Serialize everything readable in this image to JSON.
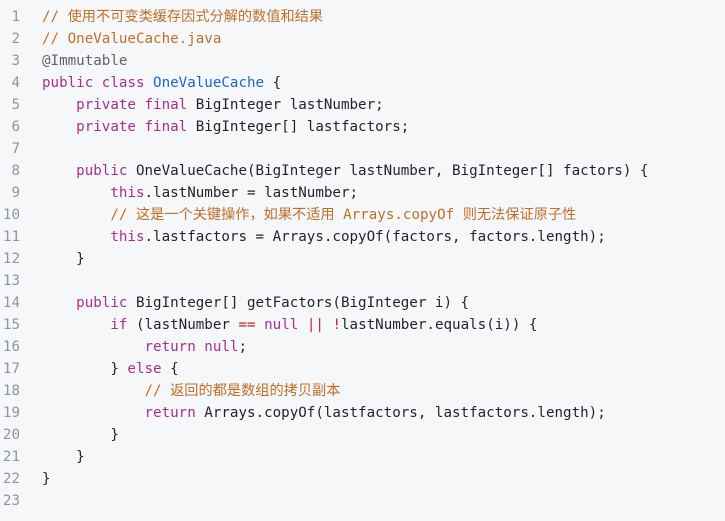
{
  "colors": {
    "background": "#f6f7f9",
    "line_number": "#8f959e",
    "comment": "#c06f2a",
    "keyword": "#a72f8a",
    "type": "#1967d2",
    "annotation": "#5f6368",
    "text": "#1f2329"
  },
  "lines": [
    {
      "n": "1",
      "tokens": [
        {
          "t": "// 使用不可变类缓存因式分解的数值和结果",
          "c": "cm"
        }
      ]
    },
    {
      "n": "2",
      "tokens": [
        {
          "t": "// OneValueCache.java",
          "c": "cm"
        }
      ]
    },
    {
      "n": "3",
      "tokens": [
        {
          "t": "@Immutable",
          "c": "at"
        }
      ]
    },
    {
      "n": "4",
      "tokens": [
        {
          "t": "public class ",
          "c": "kw"
        },
        {
          "t": "OneValueCache",
          "c": "ty"
        },
        {
          "t": " {",
          "c": "tx"
        }
      ]
    },
    {
      "n": "5",
      "tokens": [
        {
          "t": "    ",
          "c": "tx"
        },
        {
          "t": "private final ",
          "c": "kw"
        },
        {
          "t": "BigInteger lastNumber;",
          "c": "tx"
        }
      ]
    },
    {
      "n": "6",
      "tokens": [
        {
          "t": "    ",
          "c": "tx"
        },
        {
          "t": "private final ",
          "c": "kw"
        },
        {
          "t": "BigInteger[] lastfactors;",
          "c": "tx"
        }
      ]
    },
    {
      "n": "7",
      "tokens": []
    },
    {
      "n": "8",
      "tokens": [
        {
          "t": "    ",
          "c": "tx"
        },
        {
          "t": "public ",
          "c": "kw"
        },
        {
          "t": "OneValueCache(BigInteger lastNumber, BigInteger[] factors) {",
          "c": "tx"
        }
      ]
    },
    {
      "n": "9",
      "tokens": [
        {
          "t": "        ",
          "c": "tx"
        },
        {
          "t": "this",
          "c": "kw"
        },
        {
          "t": ".lastNumber = lastNumber;",
          "c": "tx"
        }
      ]
    },
    {
      "n": "10",
      "tokens": [
        {
          "t": "        ",
          "c": "tx"
        },
        {
          "t": "// 这是一个关键操作，如果不适用 Arrays.copyOf 则无法保证原子性",
          "c": "cm"
        }
      ]
    },
    {
      "n": "11",
      "tokens": [
        {
          "t": "        ",
          "c": "tx"
        },
        {
          "t": "this",
          "c": "kw"
        },
        {
          "t": ".lastfactors = Arrays.copyOf(factors, factors.length);",
          "c": "tx"
        }
      ]
    },
    {
      "n": "12",
      "tokens": [
        {
          "t": "    }",
          "c": "tx"
        }
      ]
    },
    {
      "n": "13",
      "tokens": []
    },
    {
      "n": "14",
      "tokens": [
        {
          "t": "    ",
          "c": "tx"
        },
        {
          "t": "public ",
          "c": "kw"
        },
        {
          "t": "BigInteger[] getFactors(BigInteger i) {",
          "c": "tx"
        }
      ]
    },
    {
      "n": "15",
      "tokens": [
        {
          "t": "        ",
          "c": "tx"
        },
        {
          "t": "if ",
          "c": "kw"
        },
        {
          "t": "(lastNumber ",
          "c": "tx"
        },
        {
          "t": "==",
          "c": "op"
        },
        {
          "t": " ",
          "c": "tx"
        },
        {
          "t": "null",
          "c": "kw"
        },
        {
          "t": " ",
          "c": "tx"
        },
        {
          "t": "||",
          "c": "op"
        },
        {
          "t": " ",
          "c": "tx"
        },
        {
          "t": "!",
          "c": "op"
        },
        {
          "t": "lastNumber.equals(i)) {",
          "c": "tx"
        }
      ]
    },
    {
      "n": "16",
      "tokens": [
        {
          "t": "            ",
          "c": "tx"
        },
        {
          "t": "return null",
          "c": "kw"
        },
        {
          "t": ";",
          "c": "tx"
        }
      ]
    },
    {
      "n": "17",
      "tokens": [
        {
          "t": "        } ",
          "c": "tx"
        },
        {
          "t": "else",
          "c": "kw"
        },
        {
          "t": " {",
          "c": "tx"
        }
      ]
    },
    {
      "n": "18",
      "tokens": [
        {
          "t": "            ",
          "c": "tx"
        },
        {
          "t": "// 返回的都是数组的拷贝副本",
          "c": "cm"
        }
      ]
    },
    {
      "n": "19",
      "tokens": [
        {
          "t": "            ",
          "c": "tx"
        },
        {
          "t": "return ",
          "c": "kw"
        },
        {
          "t": "Arrays.copyOf(lastfactors, lastfactors.length);",
          "c": "tx"
        }
      ]
    },
    {
      "n": "20",
      "tokens": [
        {
          "t": "        }",
          "c": "tx"
        }
      ]
    },
    {
      "n": "21",
      "tokens": [
        {
          "t": "    }",
          "c": "tx"
        }
      ]
    },
    {
      "n": "22",
      "tokens": [
        {
          "t": "}",
          "c": "tx"
        }
      ]
    },
    {
      "n": "23",
      "tokens": []
    }
  ]
}
